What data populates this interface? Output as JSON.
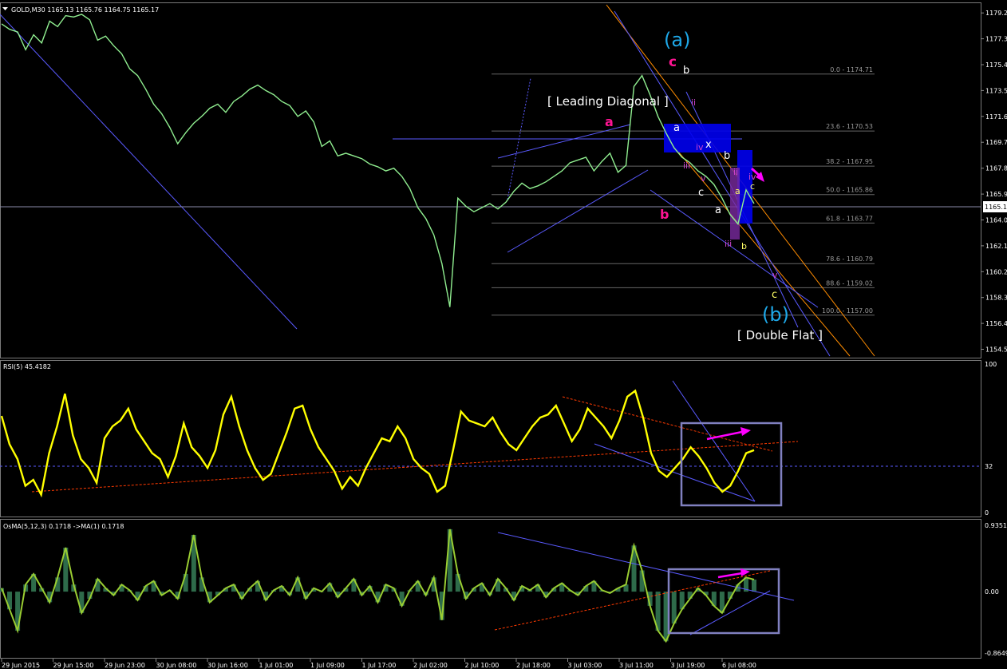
{
  "chart_data": [
    {
      "type": "line",
      "panel": "price",
      "title": "GOLD,M30  1165.13 1165.76 1164.75 1165.17",
      "ylim": [
        1154.0,
        1179.8
      ],
      "y_ticks": [
        "1179.2",
        "1177.3",
        "1175.4",
        "1173.5",
        "1171.6",
        "1169.7",
        "1167.8",
        "1165.9",
        "1164.0",
        "1162.1",
        "1160.2",
        "1158.3",
        "1156.4",
        "1154.5"
      ],
      "current_price_label": "1165.1",
      "current_price": 1165.17,
      "close_series_y": [
        1178.4,
        1178.0,
        1177.8,
        1176.5,
        1177.6,
        1177.0,
        1178.6,
        1178.2,
        1179.0,
        1178.9,
        1179.1,
        1178.7,
        1177.2,
        1177.5,
        1176.8,
        1176.2,
        1175.1,
        1174.6,
        1173.6,
        1172.5,
        1171.8,
        1170.8,
        1169.6,
        1170.4,
        1171.1,
        1171.6,
        1172.2,
        1172.5,
        1171.9,
        1172.7,
        1173.1,
        1173.6,
        1173.9,
        1173.5,
        1173.2,
        1172.7,
        1172.4,
        1171.6,
        1172.0,
        1171.2,
        1169.4,
        1169.8,
        1168.7,
        1168.9,
        1168.7,
        1168.5,
        1168.1,
        1167.9,
        1167.6,
        1167.8,
        1167.2,
        1166.3,
        1164.9,
        1164.1,
        1162.9,
        1160.8,
        1157.6,
        1165.6,
        1165.0,
        1164.6,
        1164.9,
        1165.2,
        1164.8,
        1165.3,
        1166.1,
        1166.7,
        1166.3,
        1166.5,
        1166.8,
        1167.2,
        1167.6,
        1168.2,
        1168.4,
        1168.6,
        1167.6,
        1168.3,
        1168.9,
        1167.5,
        1168.0,
        1173.8,
        1174.6,
        1173.2,
        1171.6,
        1170.4,
        1169.3,
        1168.6,
        1168.2,
        1167.6,
        1167.2,
        1166.6,
        1165.6,
        1164.4,
        1163.7,
        1166.2,
        1165.2
      ],
      "x_ticks": [
        "29 Jun 2015",
        "29 Jun 15:00",
        "29 Jun 23:00",
        "30 Jun 08:00",
        "30 Jun 16:00",
        "1 Jul 01:00",
        "1 Jul 09:00",
        "1 Jul 17:00",
        "2 Jul 02:00",
        "2 Jul 10:00",
        "2 Jul 18:00",
        "3 Jul 03:00",
        "3 Jul 11:00",
        "3 Jul 19:00",
        "6 Jul 08:00"
      ],
      "fibonacci_levels": [
        {
          "label": "0.0 - 1174.71",
          "y": 1174.71
        },
        {
          "label": "23.6 - 1170.53",
          "y": 1170.53
        },
        {
          "label": "38.2 - 1167.95",
          "y": 1167.95
        },
        {
          "label": "50.0 - 1165.86",
          "y": 1165.86
        },
        {
          "label": "61.8 - 1163.77",
          "y": 1163.77
        },
        {
          "label": "78.6 - 1160.79",
          "y": 1160.79
        },
        {
          "label": "88.6 - 1159.02",
          "y": 1159.02
        },
        {
          "label": "100.0 - 1157.00",
          "y": 1157.0
        }
      ],
      "annotations": {
        "wave_a_big": "(a)",
        "wave_b_big": "(b)",
        "leading_diagonal": "[ Leading Diagonal ]",
        "double_flat": "[ Double Flat ]",
        "pink_a": "a",
        "pink_b": "b",
        "pink_c": "c",
        "w_b_top": "b",
        "w_a_mid": "a",
        "w_x": "x",
        "w_b_mid": "b",
        "w_c": "c",
        "w_a_low": "a",
        "w_b_low": "b",
        "w_a_small": "a",
        "v_ii": "ii",
        "v_iv": "iv",
        "v_iii": "iii",
        "v_v": "v",
        "v_iii2": "iii",
        "v_ii2": "ii",
        "v_iv2": "iv",
        "v_v2": "v",
        "y_c2": "c",
        "c_low": "c"
      },
      "colors": {
        "price": "#90ee90",
        "fib": "#808080",
        "channel": "#5a5aff",
        "orange": "#ff8c00",
        "pink": "#ff1493",
        "magenta": "#ff00ff",
        "cyan": "#1ea8e8",
        "box": "#0000ee"
      }
    },
    {
      "type": "line",
      "panel": "rsi",
      "title": "RSI(5) 45.4182",
      "ylim": [
        0,
        100
      ],
      "y_ticks": [
        "100",
        "32",
        "0"
      ],
      "level": 32,
      "values": [
        65,
        46,
        36,
        18,
        22,
        12,
        40,
        58,
        80,
        52,
        36,
        30,
        20,
        50,
        58,
        62,
        70,
        56,
        48,
        40,
        36,
        24,
        38,
        60,
        44,
        38,
        30,
        42,
        66,
        78,
        58,
        42,
        30,
        22,
        26,
        40,
        54,
        70,
        72,
        56,
        44,
        36,
        28,
        16,
        24,
        18,
        30,
        40,
        50,
        48,
        58,
        50,
        36,
        30,
        26,
        14,
        18,
        42,
        68,
        62,
        60,
        58,
        64,
        54,
        46,
        42,
        50,
        58,
        64,
        66,
        72,
        60,
        48,
        56,
        70,
        64,
        58,
        50,
        62,
        78,
        82,
        64,
        40,
        28,
        24,
        30,
        36,
        44,
        38,
        30,
        20,
        14,
        18,
        28,
        40,
        42
      ]
    },
    {
      "type": "line",
      "panel": "osma",
      "title": "OsMA(5,12,3) 0.1718  ->MA(1) 0.1718",
      "ylim": [
        -0.8649,
        0.9351
      ],
      "y_ticks": [
        "0.9351",
        "0.00",
        "-0.8649"
      ],
      "values": [
        0.05,
        -0.25,
        -0.55,
        0.1,
        0.25,
        0.05,
        -0.15,
        0.2,
        0.62,
        0.1,
        -0.3,
        -0.1,
        0.18,
        0.05,
        -0.05,
        0.1,
        0.02,
        -0.12,
        0.08,
        0.15,
        -0.05,
        0.02,
        -0.1,
        0.25,
        0.8,
        0.2,
        -0.15,
        -0.05,
        0.05,
        0.1,
        -0.1,
        0.05,
        0.15,
        -0.12,
        0.02,
        0.08,
        -0.05,
        0.2,
        -0.1,
        0.05,
        0.0,
        0.12,
        -0.08,
        0.05,
        0.18,
        -0.05,
        0.08,
        -0.15,
        0.1,
        0.05,
        -0.2,
        0.02,
        0.15,
        -0.05,
        0.2,
        -0.4,
        0.88,
        0.25,
        -0.1,
        0.05,
        0.12,
        -0.05,
        0.18,
        0.05,
        -0.12,
        0.08,
        0.02,
        0.1,
        -0.08,
        0.05,
        0.12,
        0.02,
        -0.05,
        0.08,
        0.15,
        0.02,
        -0.02,
        0.05,
        0.1,
        0.65,
        0.3,
        -0.2,
        -0.55,
        -0.7,
        -0.45,
        -0.25,
        -0.1,
        0.05,
        -0.05,
        -0.2,
        -0.3,
        -0.1,
        0.1,
        0.2,
        0.17
      ]
    }
  ]
}
